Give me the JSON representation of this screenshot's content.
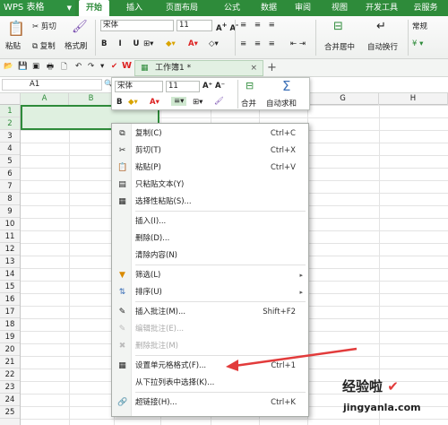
{
  "app": {
    "name": "WPS 表格"
  },
  "tabs": [
    "开始",
    "插入",
    "页面布局",
    "公式",
    "数据",
    "审阅",
    "视图",
    "开发工具",
    "云服务"
  ],
  "ribbon": {
    "paste": "粘贴",
    "cut": "剪切",
    "copy": "复制",
    "format_painter": "格式刷",
    "font": "宋体",
    "size": "11",
    "merge": "合并居中",
    "wrap": "自动换行",
    "number_format": "常规"
  },
  "document": {
    "tab_title": "工作簿1 *",
    "cell_ref": "A1",
    "new_tab": "+"
  },
  "columns": [
    "A",
    "B",
    "C",
    "D",
    "E",
    "F",
    "G",
    "H"
  ],
  "rows": [
    "1",
    "2",
    "3",
    "4",
    "5",
    "6",
    "7",
    "8",
    "9",
    "10",
    "11",
    "12",
    "13",
    "14",
    "15",
    "16",
    "17",
    "18",
    "19",
    "20",
    "21",
    "22",
    "23",
    "24",
    "25"
  ],
  "mini_toolbar": {
    "font": "宋体",
    "size": "11",
    "merge": "合并",
    "autosum": "自动求和"
  },
  "context_menu": [
    {
      "label": "复制(C)",
      "shortcut": "Ctrl+C",
      "icon": "copy-icon",
      "glyph": "⧉"
    },
    {
      "label": "剪切(T)",
      "shortcut": "Ctrl+X",
      "icon": "scissors-icon",
      "glyph": "✂"
    },
    {
      "label": "粘贴(P)",
      "shortcut": "Ctrl+V",
      "icon": "paste-icon",
      "glyph": "📋"
    },
    {
      "label": "只粘贴文本(Y)",
      "shortcut": "",
      "icon": "paste-text-icon",
      "glyph": "▤"
    },
    {
      "label": "选择性粘贴(S)...",
      "shortcut": "",
      "icon": "paste-special-icon",
      "glyph": "▦"
    },
    {
      "label": "插入(I)...",
      "shortcut": "",
      "icon": "",
      "glyph": ""
    },
    {
      "label": "删除(D)...",
      "shortcut": "",
      "icon": "",
      "glyph": ""
    },
    {
      "label": "清除内容(N)",
      "shortcut": "",
      "icon": "",
      "glyph": ""
    },
    {
      "label": "筛选(L)",
      "shortcut": "",
      "icon": "filter-icon",
      "glyph": "▼",
      "submenu": true
    },
    {
      "label": "排序(U)",
      "shortcut": "",
      "icon": "sort-icon",
      "glyph": "⇅",
      "submenu": true
    },
    {
      "label": "插入批注(M)...",
      "shortcut": "Shift+F2",
      "icon": "comment-icon",
      "glyph": "✎"
    },
    {
      "label": "编辑批注(E)...",
      "shortcut": "",
      "icon": "edit-comment-icon",
      "glyph": "✎",
      "disabled": true
    },
    {
      "label": "删除批注(M)",
      "shortcut": "",
      "icon": "delete-comment-icon",
      "glyph": "✖",
      "disabled": true
    },
    {
      "label": "设置单元格格式(F)...",
      "shortcut": "Ctrl+1",
      "icon": "format-cells-icon",
      "glyph": "▦"
    },
    {
      "label": "从下拉列表中选择(K)...",
      "shortcut": "",
      "icon": "",
      "glyph": ""
    },
    {
      "label": "超链接(H)...",
      "shortcut": "Ctrl+K",
      "icon": "hyperlink-icon",
      "glyph": "🔗"
    }
  ],
  "watermark": {
    "text": "经验啦",
    "url": "jingyanla.com"
  },
  "colors": {
    "accent": "#2e8b3a",
    "arrow": "#e23b3b"
  }
}
